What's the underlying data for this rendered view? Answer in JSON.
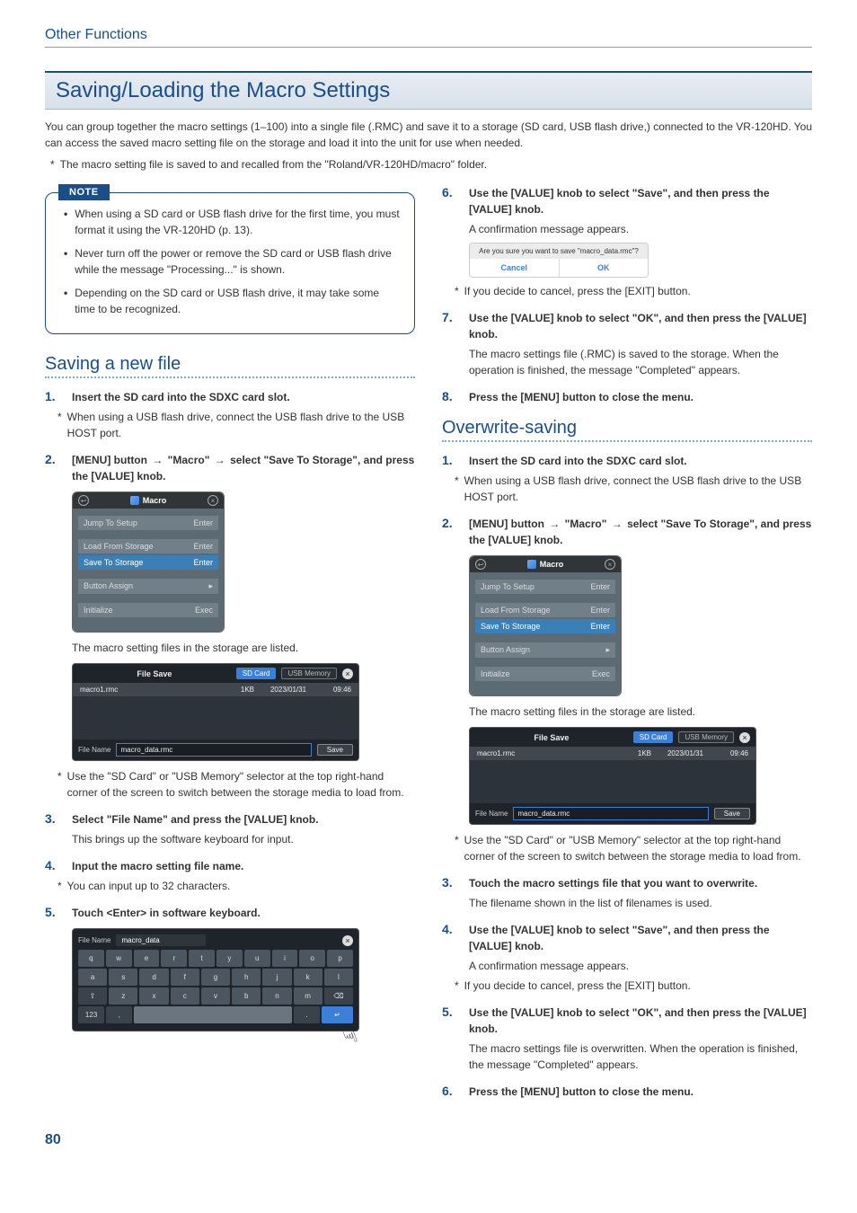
{
  "header": {
    "section": "Other Functions"
  },
  "title": "Saving/Loading the Macro Settings",
  "intro1": "You can group together the macro settings (1–100) into a single file (.RMC) and save it to a storage (SD card, USB flash drive,) connected to the VR-120HD. You can access the saved macro setting file on the storage and load it into the unit for use when needed.",
  "intro_note": "The macro setting file is saved to and recalled from the \"Roland/VR-120HD/macro\" folder.",
  "noteLabel": "NOTE",
  "notes": [
    "When using a SD card or USB flash drive for the first time, you must format it using the VR-120HD (p. 13).",
    "Never turn off the power or remove the SD card or USB flash drive while the message \"Processing...\" is shown.",
    "Depending on the SD card or USB flash drive, it may take some time to be recognized."
  ],
  "savingNew": {
    "heading": "Saving a new file",
    "steps": {
      "s1": {
        "title": "Insert the SD card into the SDXC card slot.",
        "note": "When using a USB flash drive, connect the USB flash drive to the USB HOST port."
      },
      "s2": {
        "pre": "[MENU] button",
        "mid1": "\"Macro\"",
        "mid2": "select \"Save To Storage\", and press the [VALUE] knob.",
        "caption": "The macro setting files in the storage are listed.",
        "note": "Use the \"SD Card\" or \"USB Memory\" selector at the top right-hand corner of the screen to switch between the storage media to load from."
      },
      "s3": {
        "title": "Select \"File Name\" and press the [VALUE] knob.",
        "body": "This brings up the software keyboard for input."
      },
      "s4": {
        "title": "Input the macro setting file name.",
        "note": "You can input up to 32 characters."
      },
      "s5": {
        "title": "Touch <Enter> in software keyboard."
      }
    }
  },
  "rightSteps": {
    "s6": {
      "title": "Use the [VALUE] knob to select \"Save\", and then press the [VALUE] knob.",
      "body": "A confirmation message appears.",
      "note": "If you decide to cancel, press the [EXIT] button."
    },
    "s7": {
      "title": "Use the [VALUE] knob to select \"OK\", and then press the [VALUE] knob.",
      "body": "The macro settings file (.RMC) is saved to the storage. When the operation is finished, the message \"Completed\" appears."
    },
    "s8": {
      "title": "Press the [MENU] button to close the menu."
    }
  },
  "overwrite": {
    "heading": "Overwrite-saving",
    "steps": {
      "s1": {
        "title": "Insert the SD card into the SDXC card slot.",
        "note": "When using a USB flash drive, connect the USB flash drive to the USB HOST port."
      },
      "s2": {
        "pre": "[MENU] button",
        "mid1": "\"Macro\"",
        "mid2": "select \"Save To Storage\", and press the [VALUE] knob.",
        "caption": "The macro setting files in the storage are listed.",
        "note": "Use the \"SD Card\" or \"USB Memory\" selector at the top right-hand corner of the screen to switch between the storage media to load from."
      },
      "s3": {
        "title": "Touch the macro settings file that you want to overwrite.",
        "body": "The filename shown in the list of filenames is used."
      },
      "s4": {
        "title": "Use the [VALUE] knob to select \"Save\", and then press the [VALUE] knob.",
        "body": "A confirmation message appears.",
        "note": "If you decide to cancel, press the [EXIT] button."
      },
      "s5": {
        "title": "Use the [VALUE] knob to select \"OK\", and then press the [VALUE] knob.",
        "body": "The macro settings file is overwritten. When the operation is finished, the message \"Completed\" appears."
      },
      "s6": {
        "title": "Press the [MENU] button to close the menu."
      }
    }
  },
  "macroMenu": {
    "title": "Macro",
    "rows": {
      "jump": {
        "l": "Jump To Setup",
        "r": "Enter"
      },
      "load": {
        "l": "Load From Storage",
        "r": "Enter"
      },
      "save": {
        "l": "Save To Storage",
        "r": "Enter"
      },
      "assign": {
        "l": "Button Assign",
        "r": "▸"
      },
      "init": {
        "l": "Initialize",
        "r": "Exec"
      }
    }
  },
  "filePanel": {
    "title": "File Save",
    "sd": "SD Card",
    "usb": "USB Memory",
    "row": {
      "name": "macro1.rmc",
      "size": "1KB",
      "date": "2023/01/31",
      "time": "09:46"
    },
    "fileNameLabel": "File Name",
    "fileName": "macro_data.rmc",
    "save": "Save"
  },
  "keyboard": {
    "label": "File Name",
    "value": "macro_data",
    "row1": [
      "q",
      "w",
      "e",
      "r",
      "t",
      "y",
      "u",
      "i",
      "o",
      "p"
    ],
    "row2": [
      "a",
      "s",
      "d",
      "f",
      "g",
      "h",
      "j",
      "k",
      "l"
    ],
    "row3": [
      "⇧",
      "z",
      "x",
      "c",
      "v",
      "b",
      "n",
      "m",
      "⌫"
    ],
    "numKey": "123",
    "enter": "↵"
  },
  "confirm": {
    "msg": "Are you sure you want to save \"macro_data.rmc\"?",
    "cancel": "Cancel",
    "ok": "OK"
  },
  "pageNumber": "80"
}
